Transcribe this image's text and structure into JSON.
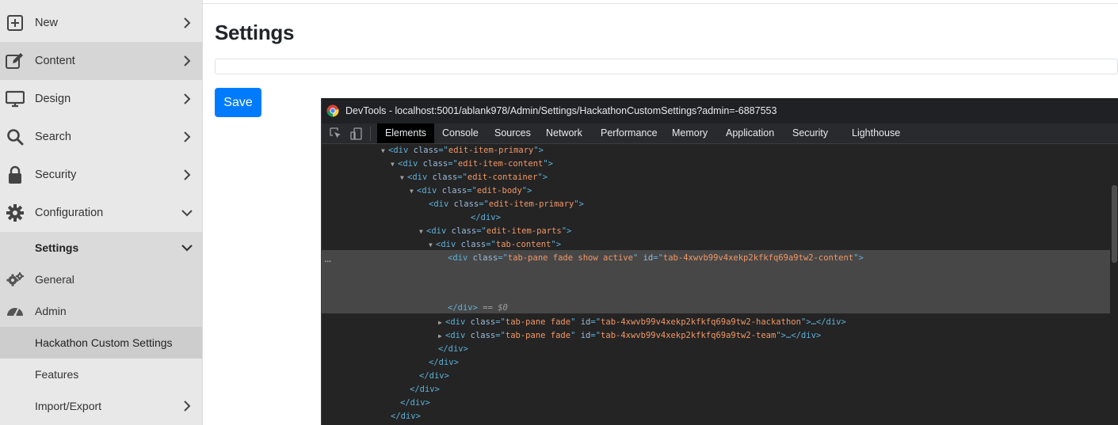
{
  "sidebar": {
    "items": [
      {
        "label": "New",
        "icon": "plus-square-icon"
      },
      {
        "label": "Content",
        "icon": "edit-icon"
      },
      {
        "label": "Design",
        "icon": "monitor-icon"
      },
      {
        "label": "Search",
        "icon": "search-icon"
      },
      {
        "label": "Security",
        "icon": "lock-icon"
      },
      {
        "label": "Configuration",
        "icon": "gear-icon"
      },
      {
        "label": "Settings"
      },
      {
        "label": "General",
        "icon": "gears-icon"
      },
      {
        "label": "Admin",
        "icon": "tachometer-icon"
      },
      {
        "label": "Hackathon Custom Settings"
      },
      {
        "label": "Features"
      },
      {
        "label": "Import/Export"
      }
    ]
  },
  "main": {
    "title": "Settings",
    "save_label": "Save",
    "primary_color": "#007bff"
  },
  "devtools": {
    "title": "DevTools - localhost:5001/ablank978/Admin/Settings/HackathonCustomSettings?admin=-6887553",
    "tabs": [
      "Elements",
      "Console",
      "Sources",
      "Network",
      "Performance",
      "Memory",
      "Application",
      "Security",
      "Lighthouse"
    ],
    "selected_tab": "Elements",
    "ellipsis": "...",
    "dom": {
      "l1": {
        "tag": "div",
        "cls": "edit-item-primary"
      },
      "l2": {
        "tag": "div",
        "cls": "edit-item-content"
      },
      "l3": {
        "tag": "div",
        "cls": "edit-container"
      },
      "l4": {
        "tag": "div",
        "cls": "edit-body"
      },
      "l5": {
        "tag": "div",
        "cls": "edit-item-primary"
      },
      "l6": {
        "close": "</div>"
      },
      "l7": {
        "tag": "div",
        "cls": "edit-item-parts"
      },
      "l8": {
        "tag": "div",
        "cls": "tab-content"
      },
      "l9": {
        "tag": "div",
        "cls": "tab-pane fade show active",
        "id": "tab-4xwvb99v4xekp2kfkfq69a9tw2-content"
      },
      "l10": {
        "close": "</div>",
        "dollar": "== $0"
      },
      "l11": {
        "tag": "div",
        "cls": "tab-pane fade",
        "id": "tab-4xwvb99v4xekp2kfkfq69a9tw2-hackathon",
        "tail": "…</div>"
      },
      "l12": {
        "tag": "div",
        "cls": "tab-pane fade",
        "id": "tab-4xwvb99v4xekp2kfkfq69a9tw2-team",
        "tail": "…</div>"
      },
      "closes": [
        "</div>",
        "</div>",
        "</div>",
        "</div>",
        "</div>",
        "</div>"
      ]
    }
  }
}
